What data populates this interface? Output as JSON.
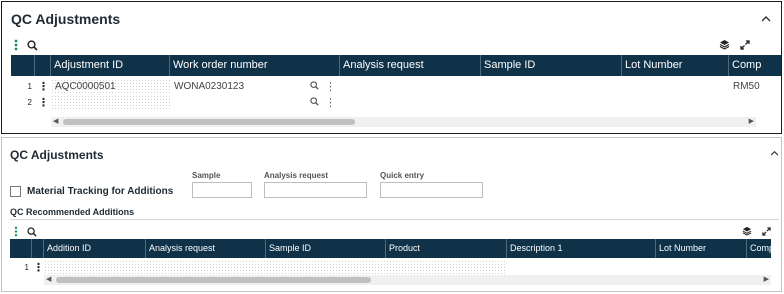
{
  "top_panel": {
    "title": "QC Adjustments",
    "columns": [
      "Adjustment ID",
      "Work order number",
      "Analysis request",
      "Sample ID",
      "Lot Number",
      "Comp"
    ],
    "rows": [
      {
        "num": "1",
        "adjustment_id": "AQC0000501",
        "work_order": "WONA0230123",
        "comp": "RM50"
      },
      {
        "num": "2",
        "adjustment_id": "",
        "work_order": "",
        "comp": ""
      }
    ]
  },
  "bottom_panel": {
    "title": "QC Adjustments",
    "material_tracking_label": "Material Tracking for Additions",
    "fields": {
      "sample_label": "Sample",
      "analysis_request_label": "Analysis request",
      "quick_entry_label": "Quick entry"
    },
    "recommended_title": "QC Recommended Additions",
    "columns": [
      "Addition ID",
      "Analysis request",
      "Sample ID",
      "Product",
      "Description 1",
      "Lot Number",
      "Comp"
    ],
    "rows": [
      {
        "num": "1"
      }
    ]
  },
  "icons": {
    "menu": "vertical-dots-icon",
    "search": "search-icon",
    "layers": "layers-icon",
    "expand": "expand-icon",
    "collapse": "chevron-up-icon"
  },
  "colors": {
    "header_bg": "#0f3249",
    "accent_green": "#1e8f6f"
  }
}
